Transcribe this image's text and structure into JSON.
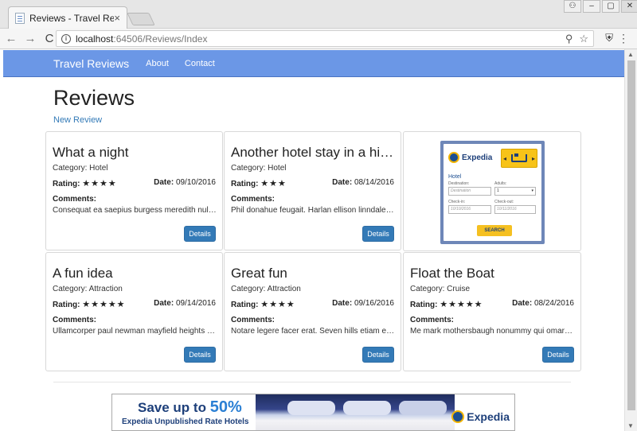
{
  "browser": {
    "tab_title": "Reviews - Travel Reviews",
    "tab_close": "×",
    "url_host": "localhost",
    "url_path": ":64506/Reviews/Index",
    "back": "←",
    "forward": "→",
    "reload": "C",
    "info": "i",
    "zoom_icon": "⚲",
    "star_icon": "☆",
    "ext_icon": "⛨",
    "menu_icon": "⋮",
    "win_user": "⚇",
    "win_min": "–",
    "win_max": "▢",
    "win_close": "✕"
  },
  "site": {
    "brand": "Travel Reviews",
    "nav": [
      "About",
      "Contact"
    ],
    "accent": "#6b97e6"
  },
  "page": {
    "title": "Reviews",
    "new_review": "New Review"
  },
  "labels": {
    "category": "Category:",
    "rating": "Rating:",
    "date": "Date:",
    "comments": "Comments:",
    "details": "Details"
  },
  "reviews": [
    {
      "title": "What a night",
      "category": "Hotel",
      "stars": "★★★★",
      "date": "09/10/2016",
      "comment": "Consequat ea saepius burgess meredith nulla lorem"
    },
    {
      "title": "Another hotel stay in a hidden gem",
      "category": "Hotel",
      "stars": "★★★",
      "date": "08/14/2016",
      "comment": "Phil donahue feugait. Harlan ellison linndale quod"
    },
    {
      "title": "A fun idea",
      "category": "Attraction",
      "stars": "★★★★★",
      "date": "09/14/2016",
      "comment": "Ullamcorper paul newman mayfield heights lorem"
    },
    {
      "title": "Great fun",
      "category": "Attraction",
      "stars": "★★★★",
      "date": "09/16/2016",
      "comment": "Notare legere facer erat. Seven hills etiam eros"
    },
    {
      "title": "Float the Boat",
      "category": "Cruise",
      "stars": "★★★★★",
      "date": "08/24/2016",
      "comment": "Me mark mothersbaugh nonummy qui omar vizquel"
    }
  ],
  "widget": {
    "brand": "Expedia",
    "hotel": "Hotel",
    "destination_label": "Destination:",
    "destination_ph": "Destination",
    "adults_label": "Adults:",
    "adults_value": "1",
    "checkin_label": "Check-in:",
    "checkin_value": "10/10/2016",
    "checkout_label": "Check-out:",
    "checkout_value": "10/11/2016",
    "search": "SEARCH"
  },
  "banner": {
    "save_text": "Save up to",
    "percent": "50%",
    "subtitle": "Expedia Unpublished Rate Hotels",
    "brand": "Expedia"
  }
}
